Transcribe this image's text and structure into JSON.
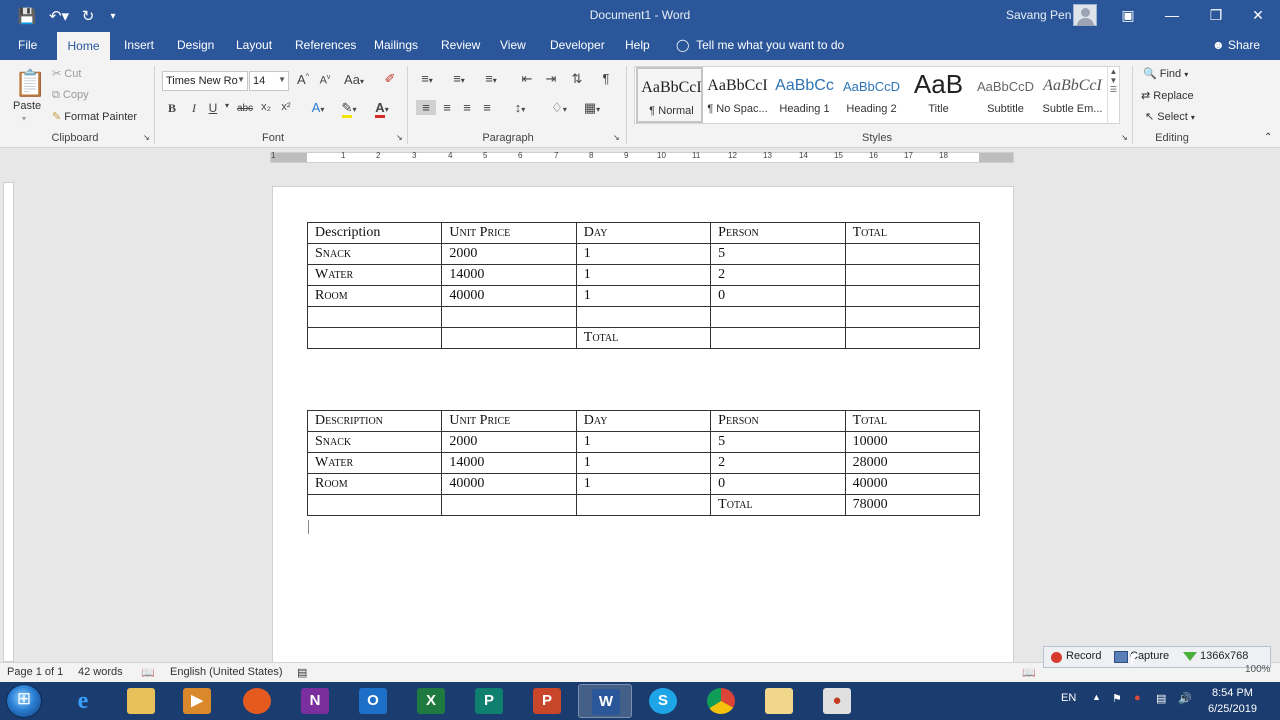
{
  "title_bar": {
    "doc_title": "Document1  -  Word",
    "user_name": "Savang Pen"
  },
  "tabs": [
    "File",
    "Home",
    "Insert",
    "Design",
    "Layout",
    "References",
    "Mailings",
    "Review",
    "View",
    "Developer",
    "Help"
  ],
  "tell_me": "Tell me what you want to do",
  "share": "Share",
  "ribbon": {
    "clipboard": {
      "paste": "Paste",
      "cut": "Cut",
      "copy": "Copy",
      "format_painter": "Format Painter",
      "label": "Clipboard"
    },
    "font": {
      "name": "Times New Ro",
      "size": "14",
      "label": "Font",
      "bold": "B",
      "italic": "I",
      "underline": "U",
      "strike": "abc",
      "subscript": "x₂",
      "superscript": "x²",
      "case": "Aa",
      "grow": "A",
      "shrink": "A"
    },
    "paragraph": {
      "label": "Paragraph"
    },
    "styles": {
      "label": "Styles",
      "items": [
        {
          "sample": "AaBbCcI",
          "name": "¶ Normal"
        },
        {
          "sample": "AaBbCcI",
          "name": "¶ No Spac..."
        },
        {
          "sample": "AaBbCc",
          "name": "Heading 1"
        },
        {
          "sample": "AaBbCcD",
          "name": "Heading 2"
        },
        {
          "sample": "AaB",
          "name": "Title"
        },
        {
          "sample": "AaBbCcD",
          "name": "Subtitle"
        },
        {
          "sample": "AaBbCcI",
          "name": "Subtle Em..."
        }
      ]
    },
    "editing": {
      "find": "Find",
      "replace": "Replace",
      "select": "Select",
      "label": "Editing"
    }
  },
  "ruler_numbers": [
    "1",
    "1",
    "2",
    "3",
    "4",
    "5",
    "6",
    "7",
    "8",
    "9",
    "10",
    "11",
    "12",
    "13",
    "14",
    "15",
    "16",
    "17",
    "18"
  ],
  "table1": {
    "rows": [
      [
        "Description",
        "Unit Price",
        "Day",
        "Person",
        "Total"
      ],
      [
        "Snack",
        "2000",
        "1",
        "5",
        ""
      ],
      [
        "Water",
        "14000",
        "1",
        "2",
        ""
      ],
      [
        "Room",
        "40000",
        "1",
        "0",
        ""
      ],
      [
        "",
        "",
        "",
        "",
        ""
      ],
      [
        "",
        "",
        "Total",
        "",
        ""
      ]
    ]
  },
  "table2": {
    "rows": [
      [
        "Description",
        "Unit Price",
        "Day",
        "Person",
        "Total"
      ],
      [
        "Snack",
        "2000",
        "1",
        "5",
        "10000"
      ],
      [
        "Water",
        "14000",
        "1",
        "2",
        "28000"
      ],
      [
        "Room",
        "40000",
        "1",
        "0",
        "40000"
      ],
      [
        "",
        "",
        "",
        "Total",
        "78000"
      ]
    ]
  },
  "status_bar": {
    "page": "Page 1 of 1",
    "words": "42 words",
    "language": "English (United States)",
    "zoom": "100%"
  },
  "capture_tool": {
    "record": "Record",
    "capture": "Capture",
    "resolution": "1366x768"
  },
  "taskbar": {
    "apps": [
      "internet-explorer",
      "file-explorer",
      "media-player",
      "firefox",
      "onenote",
      "outlook",
      "excel",
      "publisher",
      "powerpoint",
      "word",
      "skype",
      "chrome",
      "folder",
      "screen-recorder"
    ],
    "lang": "EN",
    "time": "8:54 PM",
    "date": "6/25/2019"
  },
  "colors": {
    "word_blue": "#2b579a",
    "ribbon_bg": "#f3f3f3",
    "taskbar": "#1b3c6e"
  }
}
